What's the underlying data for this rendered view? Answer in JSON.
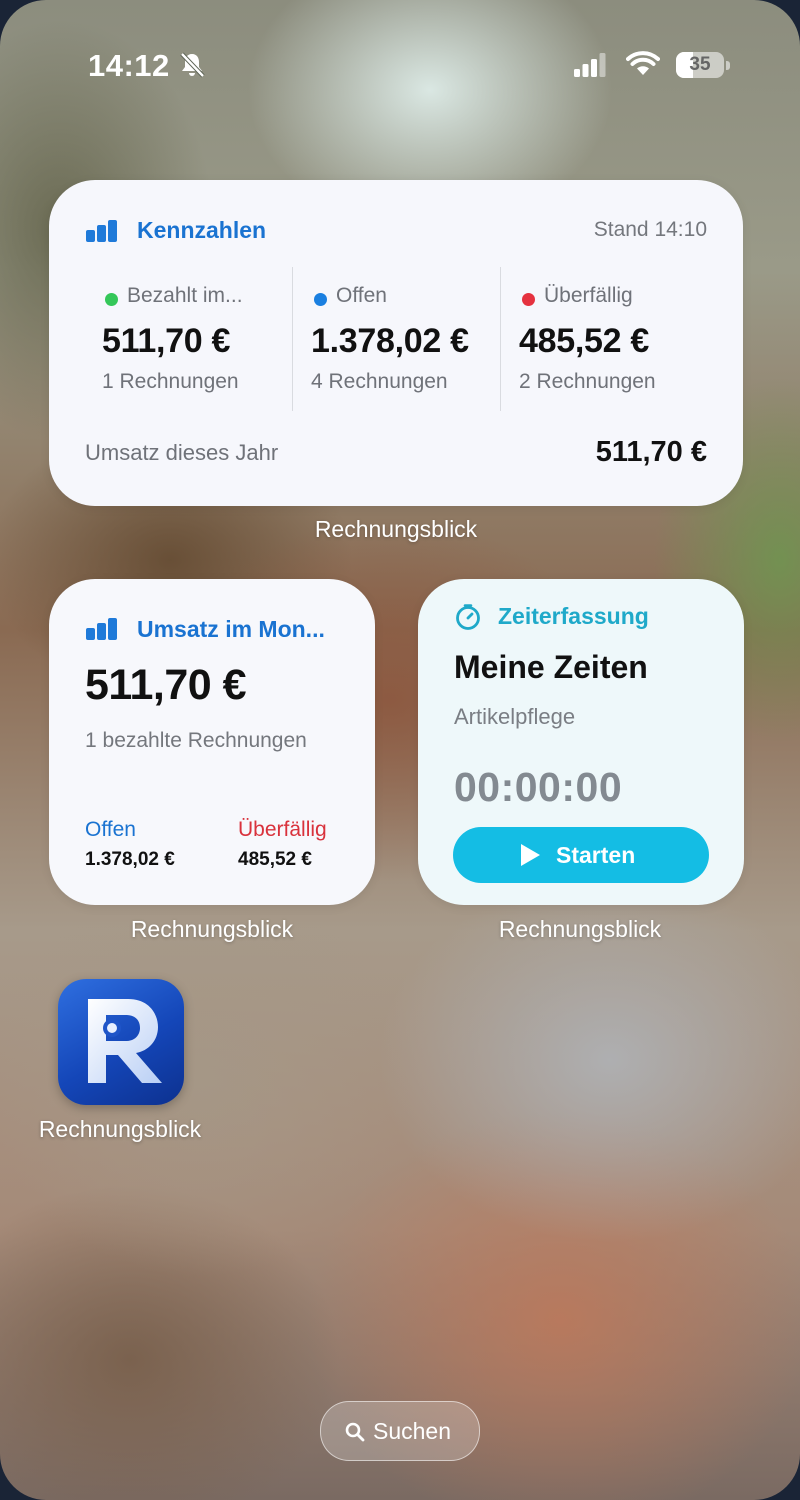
{
  "status_bar": {
    "time": "14:12",
    "battery": "35",
    "battery_level": 0.35
  },
  "kennzahlen_widget": {
    "title": "Kennzahlen",
    "stand": "Stand 14:10",
    "columns": [
      {
        "label": "Bezahlt im...",
        "amount": "511,70 €",
        "count": "1 Rechnungen",
        "dot_color": "#34c759"
      },
      {
        "label": "Offen",
        "amount": "1.378,02 €",
        "count": "4 Rechnungen",
        "dot_color": "#1a7fe0"
      },
      {
        "label": "Überfällig",
        "amount": "485,52 €",
        "count": "2 Rechnungen",
        "dot_color": "#e5323f"
      }
    ],
    "footer_label": "Umsatz dieses Jahr",
    "footer_value": "511,70 €",
    "caption": "Rechnungsblick"
  },
  "umsatz_widget": {
    "title": "Umsatz im Mon...",
    "amount": "511,70 €",
    "sub": "1 bezahlte Rechnungen",
    "offen_label": "Offen",
    "offen_value": "1.378,02 €",
    "ueberfaellig_label": "Überfällig",
    "ueberfaellig_value": "485,52 €",
    "caption": "Rechnungsblick"
  },
  "zeit_widget": {
    "title": "Zeiterfassung",
    "heading": "Meine Zeiten",
    "sub": "Artikelpflege",
    "timer": "00:00:00",
    "button": "Starten",
    "caption": "Rechnungsblick"
  },
  "app": {
    "label": "Rechnungsblick",
    "icon": "rechnungsblick-app-icon"
  },
  "search": {
    "label": "Suchen"
  },
  "colors": {
    "accent_blue": "#1a73d1",
    "accent_cyan": "#14bde4",
    "paid_green": "#34c759",
    "overdue_red": "#e5323f"
  }
}
